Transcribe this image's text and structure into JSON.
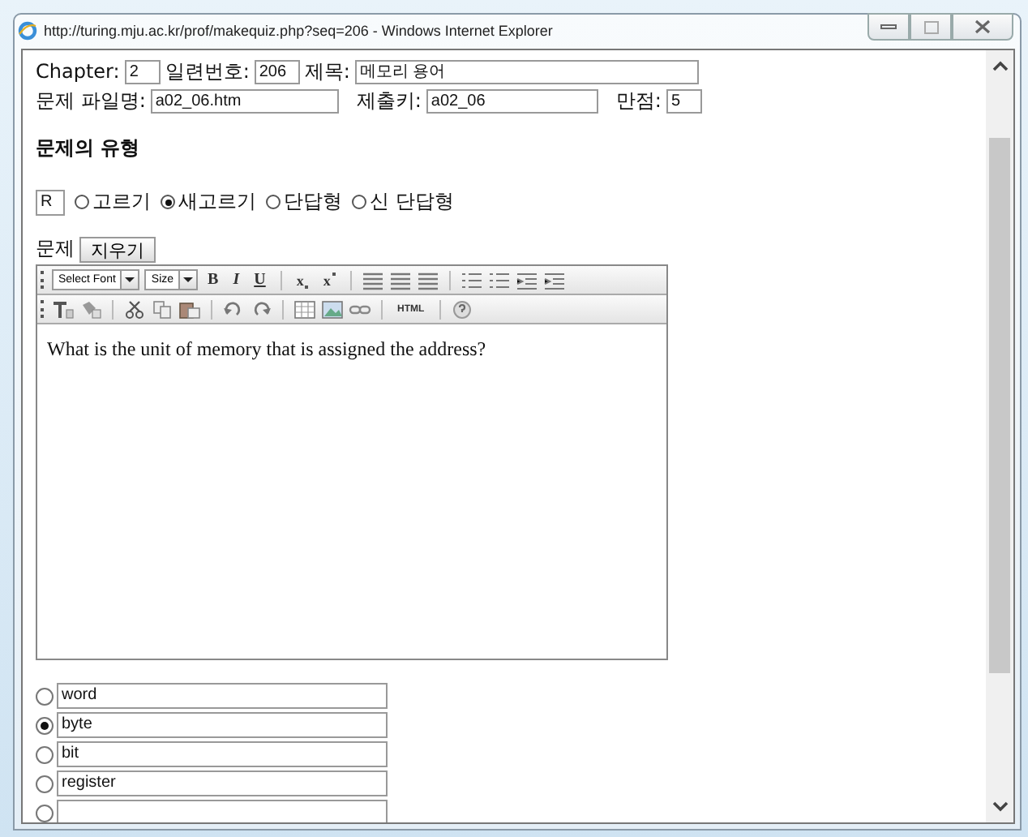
{
  "window": {
    "title": "http://turing.mju.ac.kr/prof/makequiz.php?seq=206 - Windows Internet Explorer"
  },
  "form": {
    "chapter": {
      "label": "Chapter:",
      "value": "2"
    },
    "serial": {
      "label": "일련번호:",
      "value": "206"
    },
    "title": {
      "label": "제목:",
      "value": "메모리 용어"
    },
    "file_name": {
      "label": "문제 파일명:",
      "value": "a02_06.htm"
    },
    "submit_key": {
      "label": "제출키:",
      "value": "a02_06"
    },
    "full_score": {
      "label": "만점:",
      "value": "5"
    }
  },
  "section_heading": "문제의 유형",
  "type_code": "R",
  "question_types": [
    {
      "label": "고르기",
      "selected": false
    },
    {
      "label": "새고르기",
      "selected": true
    },
    {
      "label": "단답형",
      "selected": false
    },
    {
      "label": "신 단답형",
      "selected": false
    }
  ],
  "question_label": "문제",
  "clear_button": "지우기",
  "toolbar_rows": [
    [
      {
        "kind": "dropdown",
        "label": "Select Font"
      },
      {
        "kind": "dropdown",
        "label": "Size"
      },
      {
        "kind": "bold",
        "label": "B"
      },
      {
        "kind": "italic",
        "label": "I"
      },
      {
        "kind": "underline",
        "label": "U"
      },
      {
        "kind": "sep"
      },
      {
        "kind": "subscript",
        "label": "x"
      },
      {
        "kind": "superscript",
        "label": "x"
      },
      {
        "kind": "sep"
      },
      {
        "kind": "align"
      },
      {
        "kind": "align"
      },
      {
        "kind": "align"
      },
      {
        "kind": "sep"
      },
      {
        "kind": "list"
      },
      {
        "kind": "list"
      },
      {
        "kind": "indent"
      },
      {
        "kind": "indent"
      }
    ],
    [
      {
        "kind": "textcolor"
      },
      {
        "kind": "bgcolor"
      },
      {
        "kind": "sep"
      },
      {
        "kind": "cut"
      },
      {
        "kind": "copy"
      },
      {
        "kind": "paste"
      },
      {
        "kind": "sep"
      },
      {
        "kind": "undo"
      },
      {
        "kind": "redo"
      },
      {
        "kind": "sep"
      },
      {
        "kind": "table"
      },
      {
        "kind": "image"
      },
      {
        "kind": "link"
      },
      {
        "kind": "sep"
      },
      {
        "kind": "html",
        "label": "HTML"
      },
      {
        "kind": "sep"
      },
      {
        "kind": "help"
      }
    ]
  ],
  "editor_text": "What is the unit of memory that is assigned the address?",
  "answers": [
    {
      "text": "word",
      "selected": false
    },
    {
      "text": "byte",
      "selected": true
    },
    {
      "text": "bit",
      "selected": false
    },
    {
      "text": "register",
      "selected": false
    },
    {
      "selected": false
    }
  ]
}
